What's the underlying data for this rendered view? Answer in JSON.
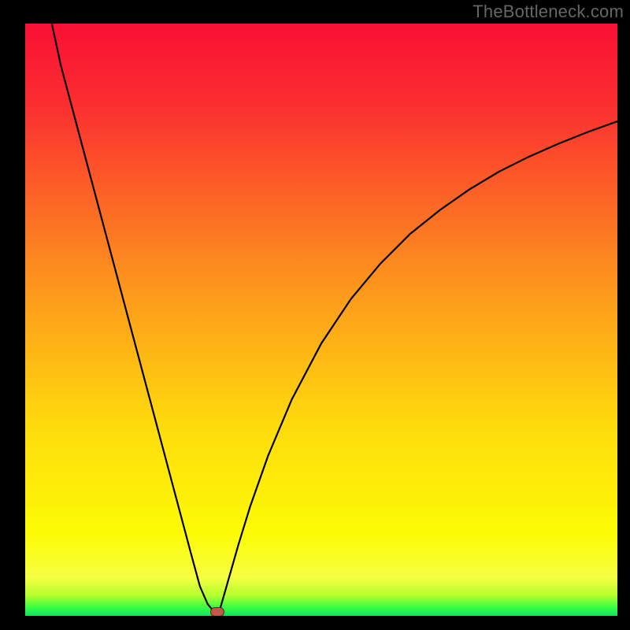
{
  "watermark": "TheBottleneck.com",
  "colors": {
    "red": "#fa1034",
    "red2": "#fb2f30",
    "orange": "#fd8f1e",
    "yellow": "#fedb0c",
    "lemon": "#fdfb05",
    "lightyellow": "#f6ff42",
    "yellgreen": "#b6ff2f",
    "green": "#3dff42",
    "brightgreen": "#06e864",
    "curve_stroke": "#000000",
    "marker_fill": "#c05a4a",
    "marker_stroke": "#6a1f15",
    "frame_bg": "#000000"
  },
  "chart_data": {
    "type": "line",
    "title": "",
    "xlabel": "",
    "ylabel": "",
    "xlim": [
      0,
      100
    ],
    "ylim": [
      0,
      100
    ],
    "grid": false,
    "background_gradient": "vertical red-yellow-green (bottleneck heatmap)",
    "series": [
      {
        "name": "left-branch",
        "x": [
          4.5,
          6,
          8,
          10,
          12,
          14,
          16,
          18,
          20,
          22,
          24,
          26,
          28,
          29.5,
          30.8,
          31.8,
          32.4
        ],
        "values": [
          100,
          93,
          85.5,
          78,
          70.5,
          63,
          55.5,
          48,
          40.5,
          33,
          25.5,
          18,
          10.5,
          5,
          2,
          0.8,
          0.2
        ]
      },
      {
        "name": "right-branch",
        "x": [
          32.4,
          33,
          34,
          36,
          38,
          41,
          45,
          50,
          55,
          60,
          65,
          70,
          75,
          80,
          85,
          90,
          95,
          100
        ],
        "values": [
          0.2,
          1.5,
          5,
          12,
          18.5,
          27,
          36.5,
          46,
          53.5,
          59.5,
          64.5,
          68.5,
          72,
          75,
          77.5,
          79.7,
          81.7,
          83.5
        ]
      }
    ],
    "marker": {
      "x": 32.4,
      "y": 0.6
    },
    "annotations": []
  }
}
